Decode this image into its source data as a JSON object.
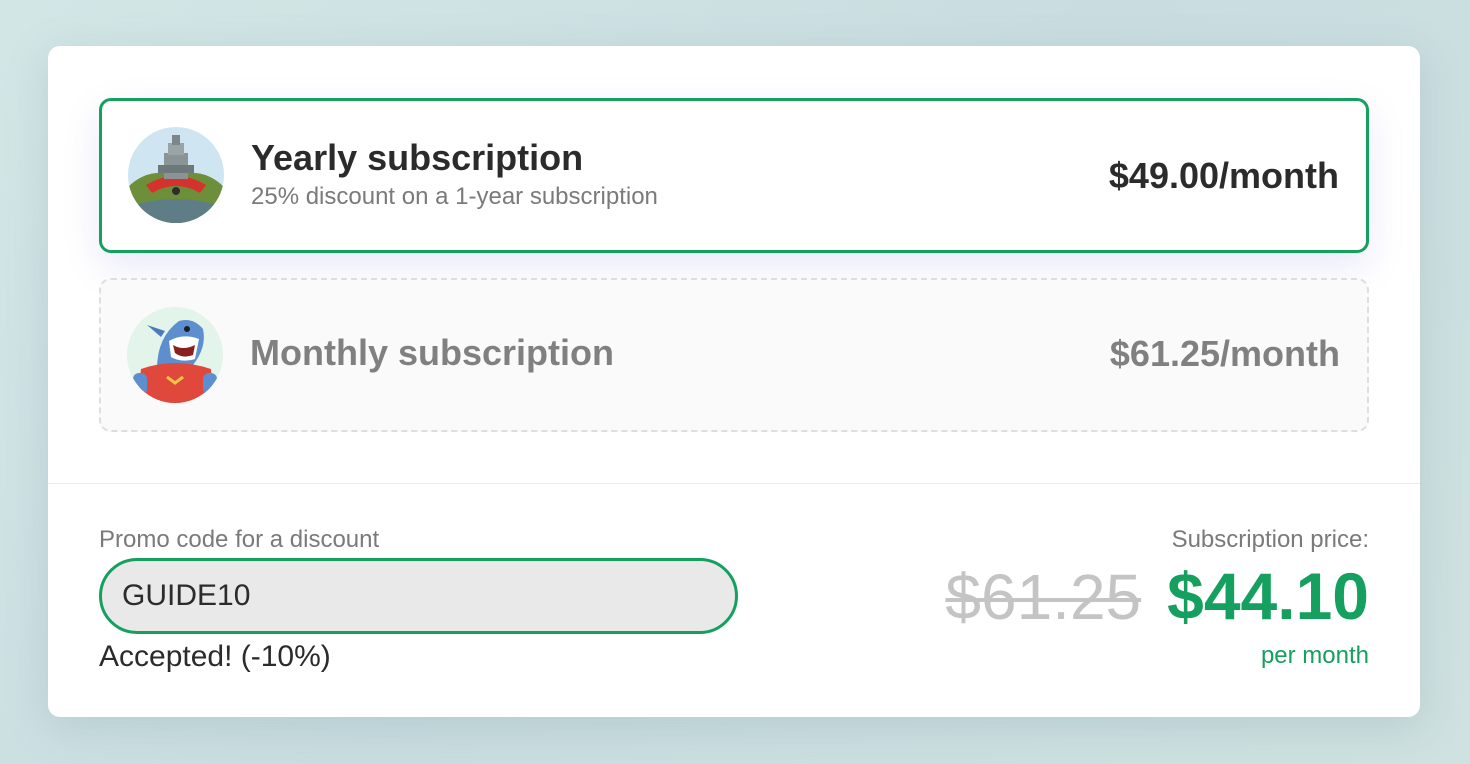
{
  "plans": [
    {
      "title": "Yearly subscription",
      "subtitle": "25% discount on a 1-year subscription",
      "price": "$49.00/month",
      "avatar_icon": "robot-avatar-icon",
      "selected": true
    },
    {
      "title": "Monthly subscription",
      "price": "$61.25/month",
      "avatar_icon": "shark-avatar-icon",
      "selected": false
    }
  ],
  "promo": {
    "label": "Promo code for a discount",
    "value": "GUIDE10",
    "status": "Accepted! (-10%)"
  },
  "summary": {
    "label": "Subscription price:",
    "old_price": "$61.25",
    "new_price": "$44.10",
    "period": "per month"
  },
  "colors": {
    "accent": "#16a05f",
    "muted_text": "#7a7a7a",
    "strikethrough": "#c4c4c4"
  }
}
